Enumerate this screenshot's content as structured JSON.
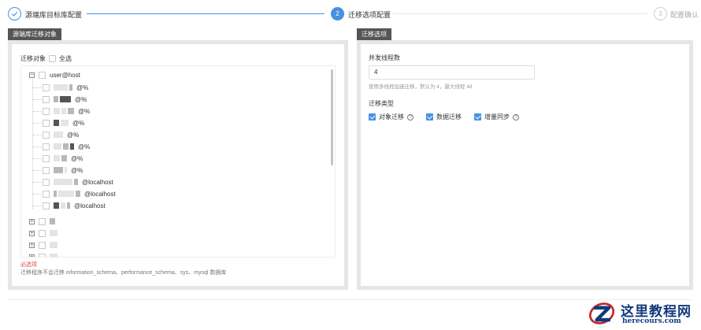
{
  "steps": [
    {
      "number": "",
      "label": "源端库目标库配置",
      "state": "done"
    },
    {
      "number": "2",
      "label": "迁移选项配置",
      "state": "active"
    },
    {
      "number": "3",
      "label": "配置确认",
      "state": "todo"
    }
  ],
  "left_panel": {
    "tab": "源端库迁移对象",
    "migrate_label": "迁移对象",
    "select_all": "全选",
    "tree_root": "user@host",
    "tree_children": [
      "@%",
      "@%",
      "@%",
      "@%",
      "@%",
      "@%",
      "@%",
      "@%",
      "@localhost",
      "@localhost",
      "@localhost"
    ],
    "collapsed_nodes": 4,
    "required_text": "必选项",
    "hint": "迁移程序不会迁移 information_schema、performance_schema、sys、mysql 数据库"
  },
  "right_panel": {
    "tab": "迁移选项",
    "threads_label": "并发线程数",
    "threads_value": "4",
    "threads_hint": "使用多线程加速迁移，默认为 4，最大线程 48",
    "type_label": "迁移类型",
    "types": [
      {
        "label": "对象迁移",
        "checked": true
      },
      {
        "label": "数据迁移",
        "checked": true
      },
      {
        "label": "增量同步",
        "checked": true
      }
    ]
  },
  "watermark": {
    "title": "这里教程网",
    "url": "herecours.com"
  },
  "colors": {
    "accent": "#4a90e2",
    "tab_bg": "#555555",
    "required": "#e04848",
    "watermark": "#123a7a"
  }
}
